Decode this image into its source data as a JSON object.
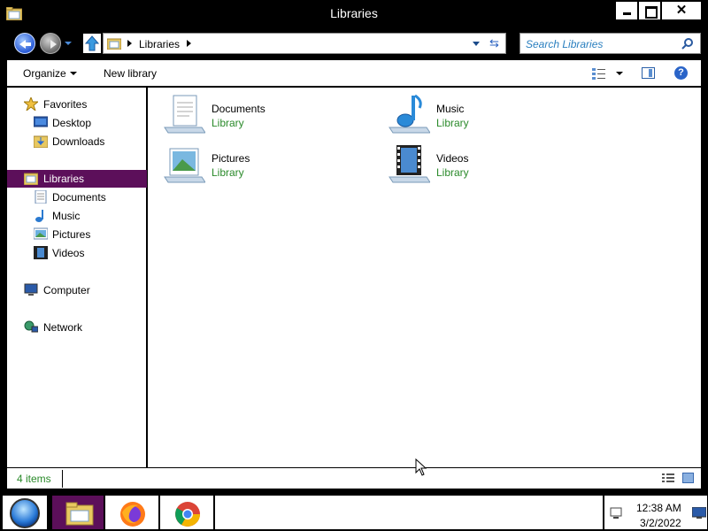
{
  "window": {
    "title": "Libraries",
    "controls": {
      "minimize": "",
      "maximize": "",
      "close": "✕"
    }
  },
  "address": {
    "path": "Libraries",
    "search_placeholder": "Search Libraries"
  },
  "toolbar": {
    "organize": "Organize",
    "new_library": "New library"
  },
  "nav": {
    "favorites": {
      "label": "Favorites",
      "items": [
        {
          "label": "Desktop",
          "icon": "desktop-icon"
        },
        {
          "label": "Downloads",
          "icon": "downloads-icon"
        }
      ]
    },
    "libraries": {
      "label": "Libraries",
      "selected": true,
      "items": [
        {
          "label": "Documents",
          "icon": "documents-icon"
        },
        {
          "label": "Music",
          "icon": "music-icon"
        },
        {
          "label": "Pictures",
          "icon": "pictures-icon"
        },
        {
          "label": "Videos",
          "icon": "videos-icon"
        }
      ]
    },
    "computer": {
      "label": "Computer"
    },
    "network": {
      "label": "Network"
    }
  },
  "content": {
    "items": [
      {
        "name": "Documents",
        "type": "Library",
        "icon": "documents-library-icon"
      },
      {
        "name": "Music",
        "type": "Library",
        "icon": "music-library-icon"
      },
      {
        "name": "Pictures",
        "type": "Library",
        "icon": "pictures-library-icon"
      },
      {
        "name": "Videos",
        "type": "Library",
        "icon": "videos-library-icon"
      }
    ]
  },
  "status": {
    "item_count": "4 items"
  },
  "taskbar": {
    "apps": [
      {
        "name": "File Explorer",
        "active": true
      },
      {
        "name": "Firefox"
      },
      {
        "name": "Chrome"
      }
    ],
    "clock": {
      "time": "12:38 AM",
      "date": "3/2/2022"
    }
  },
  "colors": {
    "selection": "#5c0f5a",
    "library_type_text": "#2a8a2a",
    "search_placeholder": "#2a7fbf"
  }
}
